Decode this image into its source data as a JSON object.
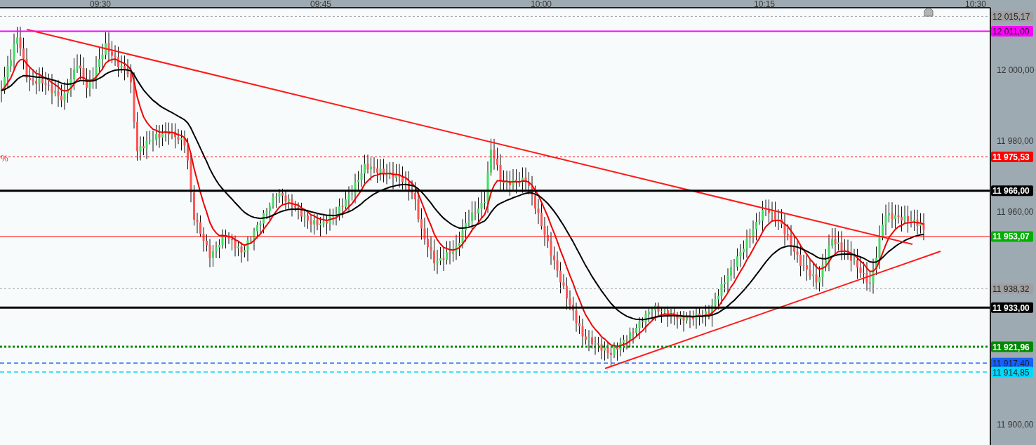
{
  "time_axis": {
    "labels": [
      "09:30",
      "09:45",
      "10:00",
      "10:15",
      "10:30"
    ]
  },
  "price_axis": {
    "ticks": [
      "12 000,00",
      "11 980,00",
      "11 960,00",
      "11 900,00"
    ]
  },
  "levels": [
    {
      "label": "12 015,17",
      "color": "#a0a0a0",
      "kind": "marker"
    },
    {
      "label": "12 011,00",
      "color": "#ff00ff",
      "kind": "alert"
    },
    {
      "label": "11 975,53",
      "color": "#ff0000",
      "kind": "target"
    },
    {
      "label": "11 966,00",
      "color": "#000000",
      "kind": "support"
    },
    {
      "label": "11 953,07",
      "color": "#00b000",
      "kind": "last"
    },
    {
      "label": "11 938,32",
      "color": "#a0a0a0",
      "kind": "marker"
    },
    {
      "label": "11 933,00",
      "color": "#000000",
      "kind": "support"
    },
    {
      "label": "11 921,96",
      "color": "#008a00",
      "kind": "pivot"
    },
    {
      "label": "11 917,40",
      "color": "#1560ff",
      "kind": "order"
    },
    {
      "label": "11 914,85",
      "color": "#00d8ff",
      "kind": "order"
    }
  ],
  "left_edge_mark": "%"
}
